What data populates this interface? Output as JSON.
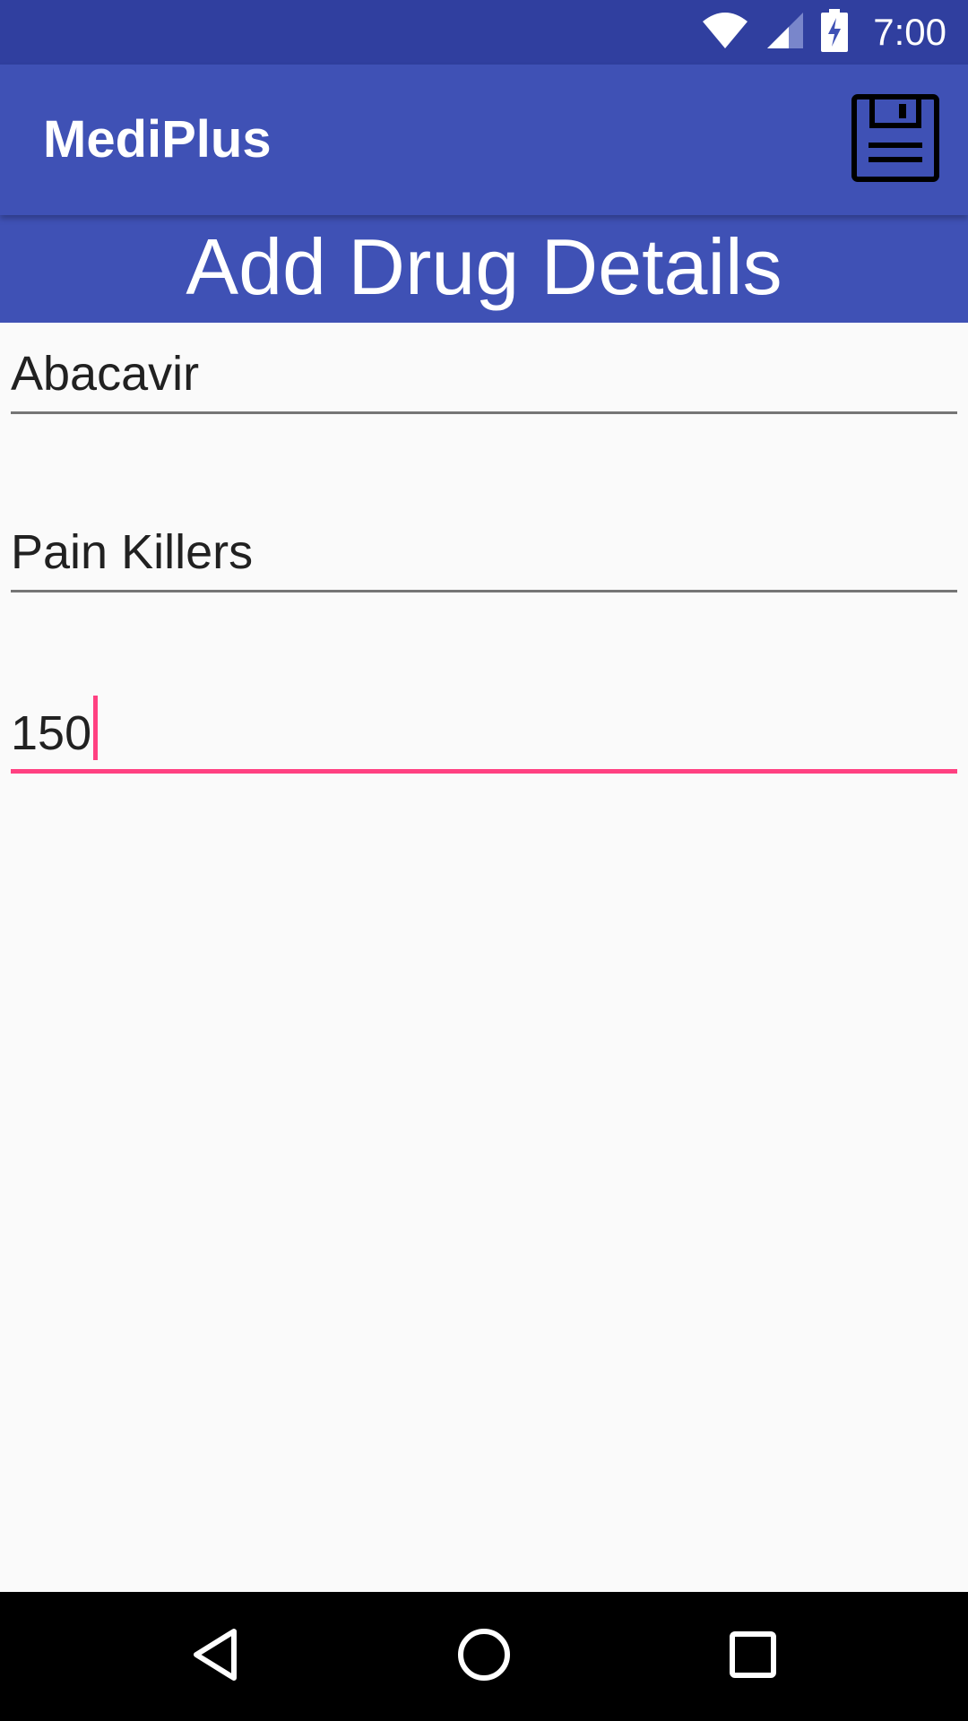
{
  "status_bar": {
    "time": "7:00",
    "icons": [
      "wifi-icon",
      "signal-icon",
      "battery-charging-icon"
    ],
    "background": "#303f9f"
  },
  "app_bar": {
    "title": "MediPlus",
    "action_icon": "save-icon",
    "background": "#3f51b5"
  },
  "header": {
    "title": "Add Drug Details"
  },
  "form": {
    "fields": [
      {
        "value": "Abacavir",
        "focused": false
      },
      {
        "value": "Pain Killers",
        "focused": false
      },
      {
        "value": "150",
        "focused": true
      }
    ],
    "accent_color": "#ff4081"
  },
  "nav_bar": {
    "icons": [
      "back-icon",
      "home-icon",
      "recents-icon"
    ]
  }
}
